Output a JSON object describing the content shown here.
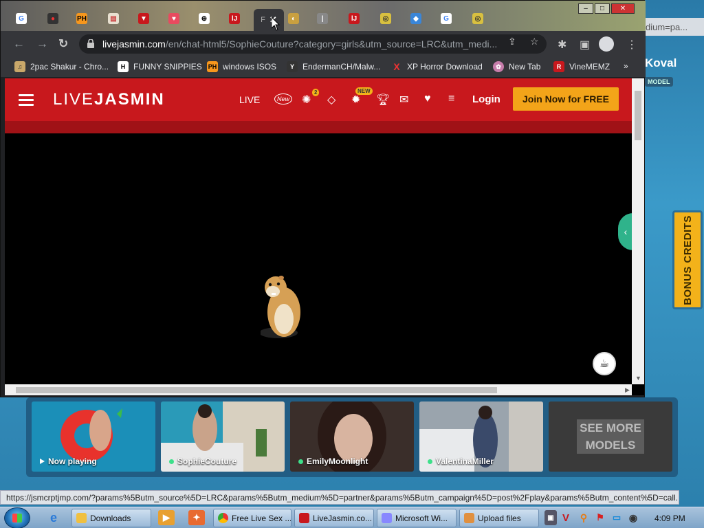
{
  "background": {
    "address_fragment": "dium=pa...",
    "model_name": "Koval",
    "model_tag": "MODEL",
    "bonus_tab": "BONUS CREDITS",
    "thumbnails": [
      {
        "label": "Now playing",
        "kind": "playing",
        "color": "#1b8fb8"
      },
      {
        "label": "SophieCouture",
        "kind": "online",
        "color": "#6a8a8a"
      },
      {
        "label": "EmilyMoonlight",
        "kind": "online",
        "color": "#5a4a44"
      },
      {
        "label": "ValentinaMiller",
        "kind": "online",
        "color": "#8a8f96"
      }
    ],
    "see_more": "SEE MORE\nMODELS"
  },
  "status_bar": "https://jsmcrptjmp.com/?params%5Butm_source%5D=LRC&params%5Butm_medium%5D=partner&params%5Butm_campaign%5D=post%2Fplay&params%5Butm_content%5D=call...",
  "browser": {
    "active_tab_title": "F",
    "window_controls": [
      "–",
      "□",
      "✕"
    ],
    "url_host": "livejasmin.com",
    "url_rest": "/en/chat-html5/SophieCouture?category=girls&utm_source=LRC&utm_medi...",
    "bookmarks": [
      {
        "label": "2pac Shakur - Chro...",
        "icon": "music-icon",
        "color": "#c9a86a",
        "glyph": "♫"
      },
      {
        "label": "FUNNY SNIPPIES",
        "icon": "h-icon",
        "color": "#ffffff",
        "glyph": "H"
      },
      {
        "label": "windows ISOS",
        "icon": "ph-icon",
        "color": "#f7971d",
        "glyph": "PH"
      },
      {
        "label": "EndermanCH/Malw...",
        "icon": "yp-icon",
        "color": "#333333",
        "glyph": "Y"
      },
      {
        "label": "XP Horror Download",
        "icon": "x-icon",
        "color": "#35363a",
        "glyph": "X"
      },
      {
        "label": "New Tab",
        "icon": "photo-icon",
        "color": "#c77dab",
        "glyph": "✿"
      },
      {
        "label": "VineMEMZ",
        "icon": "v-icon",
        "color": "#c8181d",
        "glyph": "R"
      }
    ],
    "bookmarks_overflow": "»"
  },
  "site": {
    "logo_light": "LIVE",
    "logo_bold": "JASMIN",
    "nav_live": "LIVE",
    "nav_new": "New",
    "badge_count": "2",
    "badge_new": "NEW",
    "login": "Login",
    "join": "Join Now for FREE"
  },
  "taskbar": {
    "tasks": [
      {
        "label": "Downloads",
        "color": "#f0c040"
      },
      {
        "label": "Free Live Sex ...",
        "color": "#4a90e2"
      },
      {
        "label": "LiveJasmin.co...",
        "color": "#c8181d"
      },
      {
        "label": "Microsoft Wi...",
        "color": "#8888ff"
      },
      {
        "label": "Upload files",
        "color": "#e09040"
      }
    ],
    "clock": "4:09 PM"
  },
  "colors": {
    "brand_red": "#c8181d",
    "join_orange": "#f3a419",
    "online_green": "#3de08a"
  }
}
